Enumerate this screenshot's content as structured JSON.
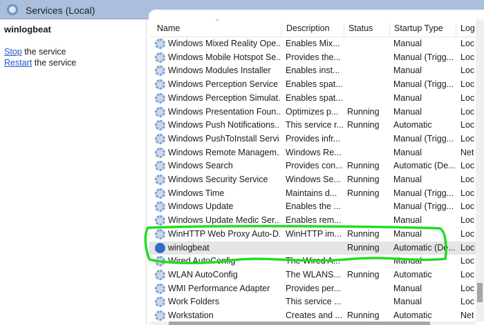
{
  "title": "Services (Local)",
  "left": {
    "service": "winlogbeat",
    "actions": [
      {
        "link": "Stop",
        "rest": " the service"
      },
      {
        "link": "Restart",
        "rest": " the service"
      }
    ]
  },
  "columns": [
    "Name",
    "Description",
    "Status",
    "Startup Type",
    "Log"
  ],
  "rows": [
    {
      "name": "Windows Mixed Reality Ope...",
      "desc": "Enables Mix...",
      "status": "",
      "startup": "Manual",
      "log": "Loc"
    },
    {
      "name": "Windows Mobile Hotspot Se...",
      "desc": "Provides the...",
      "status": "",
      "startup": "Manual (Trigg...",
      "log": "Loc"
    },
    {
      "name": "Windows Modules Installer",
      "desc": "Enables inst...",
      "status": "",
      "startup": "Manual",
      "log": "Loc"
    },
    {
      "name": "Windows Perception Service",
      "desc": "Enables spat...",
      "status": "",
      "startup": "Manual (Trigg...",
      "log": "Loc"
    },
    {
      "name": "Windows Perception Simulat...",
      "desc": "Enables spat...",
      "status": "",
      "startup": "Manual",
      "log": "Loc"
    },
    {
      "name": "Windows Presentation Foun...",
      "desc": "Optimizes p...",
      "status": "Running",
      "startup": "Manual",
      "log": "Loc"
    },
    {
      "name": "Windows Push Notifications...",
      "desc": "This service r...",
      "status": "Running",
      "startup": "Automatic",
      "log": "Loc"
    },
    {
      "name": "Windows PushToInstall Servi...",
      "desc": "Provides infr...",
      "status": "",
      "startup": "Manual (Trigg...",
      "log": "Loc"
    },
    {
      "name": "Windows Remote Managem...",
      "desc": "Windows Re...",
      "status": "",
      "startup": "Manual",
      "log": "Net"
    },
    {
      "name": "Windows Search",
      "desc": "Provides con...",
      "status": "Running",
      "startup": "Automatic (De...",
      "log": "Loc"
    },
    {
      "name": "Windows Security Service",
      "desc": "Windows Se...",
      "status": "Running",
      "startup": "Manual",
      "log": "Loc"
    },
    {
      "name": "Windows Time",
      "desc": "Maintains d...",
      "status": "Running",
      "startup": "Manual (Trigg...",
      "log": "Loc"
    },
    {
      "name": "Windows Update",
      "desc": "Enables the ...",
      "status": "",
      "startup": "Manual (Trigg...",
      "log": "Loc"
    },
    {
      "name": "Windows Update Medic Ser...",
      "desc": "Enables rem...",
      "status": "",
      "startup": "Manual",
      "log": "Loc"
    },
    {
      "name": "WinHTTP Web Proxy Auto-D...",
      "desc": "WinHTTP im...",
      "status": "Running",
      "startup": "Manual",
      "log": "Loc"
    },
    {
      "name": "winlogbeat",
      "desc": "",
      "status": "Running",
      "startup": "Automatic (De...",
      "log": "Loc",
      "selected": true
    },
    {
      "name": "Wired AutoConfig",
      "desc": "The Wired A...",
      "status": "",
      "startup": "Manual",
      "log": "Loc"
    },
    {
      "name": "WLAN AutoConfig",
      "desc": "The WLANS...",
      "status": "Running",
      "startup": "Automatic",
      "log": "Loc"
    },
    {
      "name": "WMI Performance Adapter",
      "desc": "Provides per...",
      "status": "",
      "startup": "Manual",
      "log": "Loc"
    },
    {
      "name": "Work Folders",
      "desc": "This service ...",
      "status": "",
      "startup": "Manual",
      "log": "Loc"
    },
    {
      "name": "Workstation",
      "desc": "Creates and ...",
      "status": "Running",
      "startup": "Automatic",
      "log": "Net"
    }
  ],
  "colors": {
    "highlight": "#22dd22",
    "title_bar": "#a9bfdb",
    "link": "#1a56c4"
  }
}
